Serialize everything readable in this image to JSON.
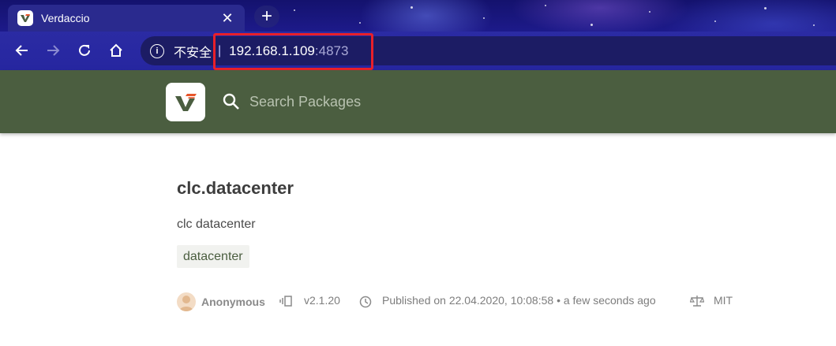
{
  "browser": {
    "tab": {
      "title": "Verdaccio",
      "close_label": "✕"
    },
    "new_tab_label": "+",
    "address_bar": {
      "security_label": "不安全",
      "separator": "|",
      "host": "192.168.1.109",
      "port": ":4873"
    },
    "icons": [
      "back-icon",
      "forward-icon",
      "reload-icon",
      "home-icon",
      "info-icon"
    ]
  },
  "header": {
    "logo": "verdaccio-logo",
    "search_placeholder": "Search Packages",
    "colors": {
      "header_bg": "#4b5e40",
      "accent": "#e8202a"
    }
  },
  "package": {
    "name": "clc.datacenter",
    "description": "clc datacenter",
    "keywords": [
      "datacenter"
    ],
    "author": "Anonymous",
    "version": "v2.1.20",
    "published": "Published on 22.04.2020, 10:08:58 • a few seconds ago",
    "license": "MIT"
  }
}
